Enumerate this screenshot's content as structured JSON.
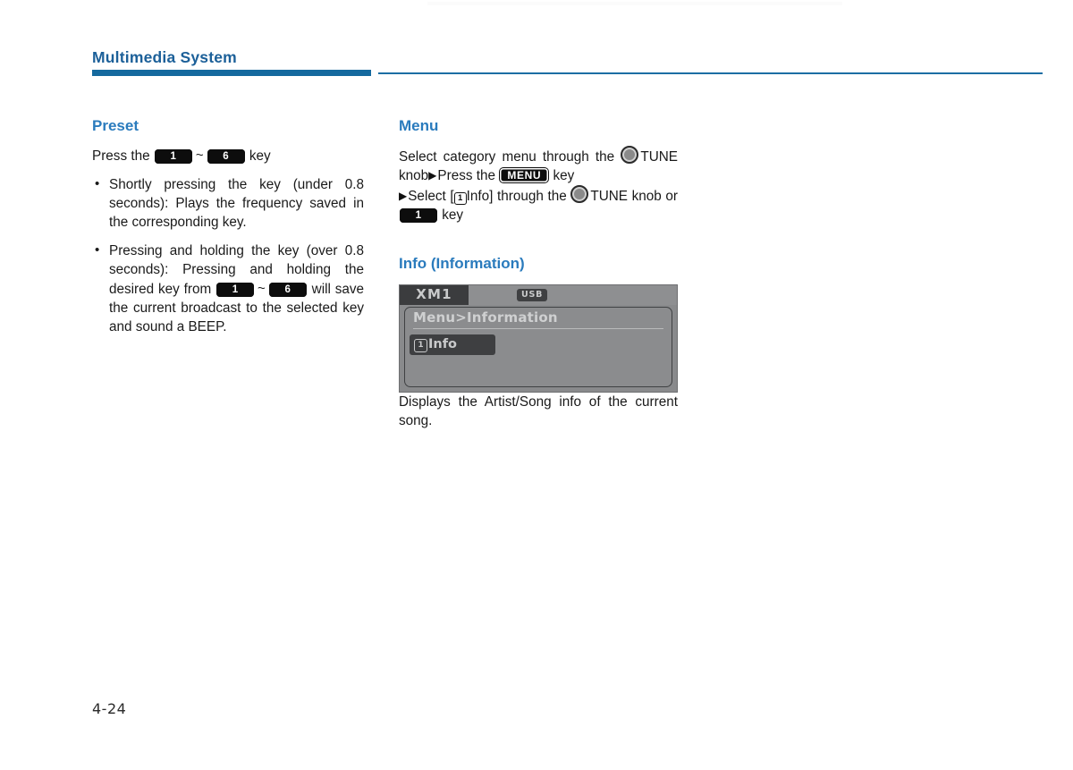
{
  "header": {
    "title": "Multimedia System"
  },
  "left_column": {
    "section_title": "Preset",
    "intro_before": "Press the",
    "key_from": "1",
    "tilde": "~",
    "key_to": "6",
    "intro_after": "key",
    "bullets": [
      "Shortly pressing the key (under 0.8 seconds): Plays the frequency saved in the corresponding key.",
      {
        "part1": "Pressing and holding the key (over 0.8 seconds): Pressing and holding the desired key from",
        "key_from": "1",
        "tilde": "~",
        "key_to": "6",
        "part2": "will save the current broadcast to the selected key and sound a BEEP."
      }
    ]
  },
  "right_column": {
    "menu": {
      "section_title": "Menu",
      "line1": "Select category menu through the",
      "knob_icon": "tune-knob-icon",
      "knob_label": "TUNE knob",
      "arrow": "▶",
      "press_the": "Press the",
      "menu_key": "MENU",
      "key_word": "key",
      "select_open": "Select [",
      "boxed_one": "1",
      "info_word": "Info] through the",
      "tune_word": "TUNE",
      "knob_or": "knob or",
      "key_one": "1",
      "key_word2": "key"
    },
    "info": {
      "section_title": "Info (Information)",
      "display": {
        "tab_label": "XM1",
        "source_badge": "USB",
        "panel_title": "Menu>Information",
        "item_number": "1",
        "item_label": "Info"
      },
      "caption": "Displays the Artist/Song info of the current song."
    }
  },
  "footer": {
    "page_number": "4-24"
  },
  "colors": {
    "heading_blue": "#1c6099",
    "section_blue": "#2a7bbd",
    "rule_blue": "#15699e",
    "keycap_black": "#0d0d0d",
    "lcd_gray": "#898a8c",
    "lcd_dark": "#3e3f41",
    "lcd_text": "#c9cacb"
  }
}
